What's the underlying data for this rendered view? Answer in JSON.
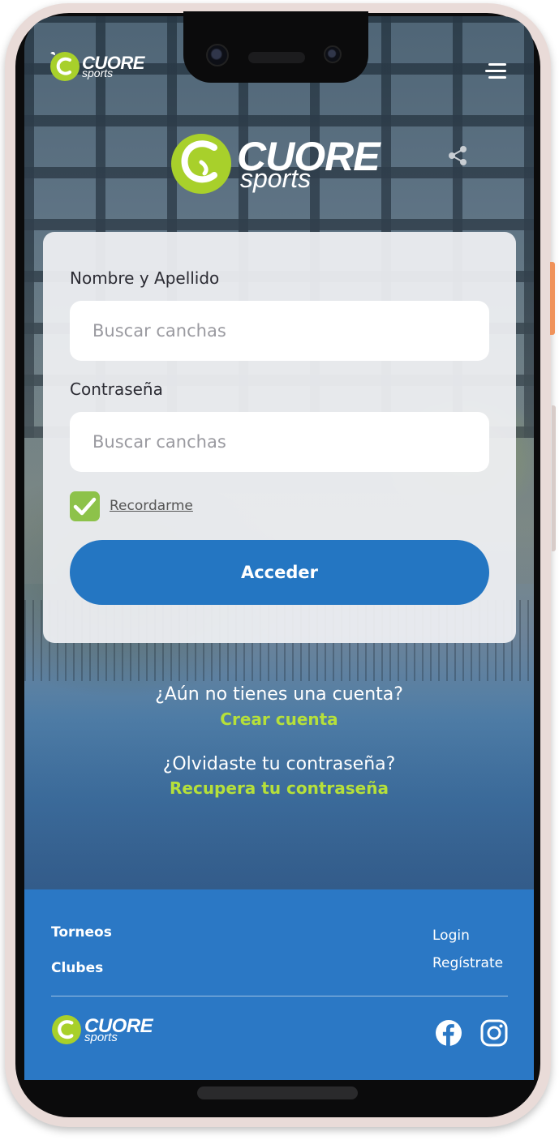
{
  "brand": {
    "name": "CUORE",
    "sub": "sports",
    "accent": "#a8d02b",
    "primary": "#2476c2"
  },
  "header": {
    "menu_icon": "hamburger-icon",
    "share_icon": "share-icon"
  },
  "login_form": {
    "name_label": "Nombre y Apellido",
    "name_placeholder": "Buscar canchas",
    "password_label": "Contraseña",
    "password_placeholder": "Buscar canchas",
    "remember_label": "Recordarme",
    "remember_checked": true,
    "submit_label": "Acceder"
  },
  "account_links": {
    "no_account_text": "¿Aún no tienes una cuenta?",
    "create_account_label": "Crear cuenta",
    "forgot_text": "¿Olvidaste tu contraseña?",
    "recover_label": "Recupera tu contraseña"
  },
  "footer": {
    "nav_left": [
      "Torneos",
      "Clubes"
    ],
    "nav_right": [
      "Login",
      "Regístrate"
    ],
    "social": [
      "facebook-icon",
      "instagram-icon"
    ]
  }
}
